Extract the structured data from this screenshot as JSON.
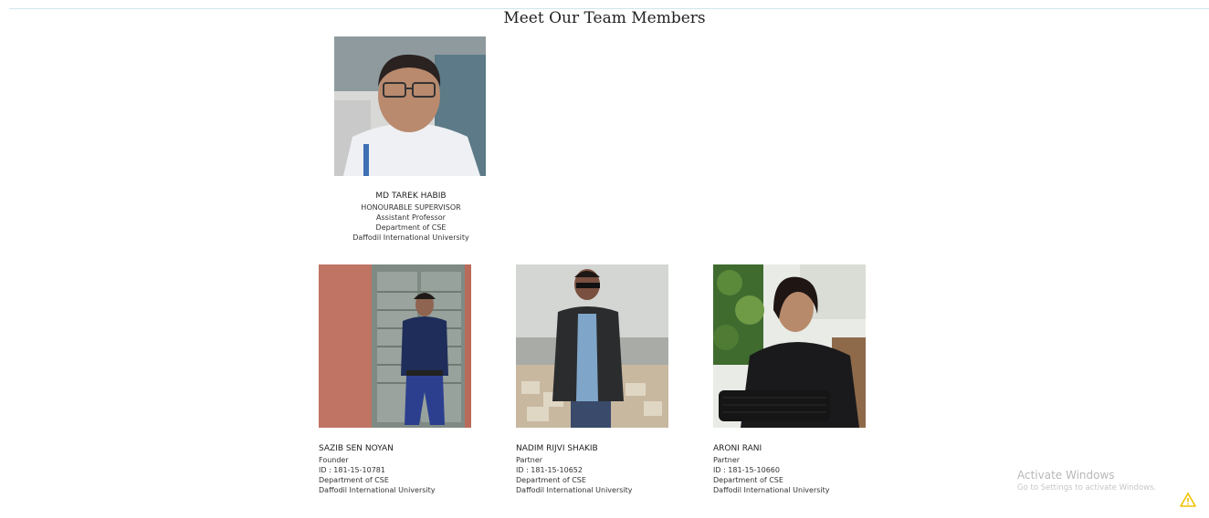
{
  "page": {
    "title": "Meet Our Team Members"
  },
  "supervisor": {
    "name": "MD TAREK HABIB",
    "role": "HONOURABLE SUPERVISOR",
    "designation": "Assistant Professor",
    "department": "Department of CSE",
    "university": "Daffodil International University"
  },
  "members": [
    {
      "name": "SAZIB SEN NOYAN",
      "role": "Founder",
      "id": "ID : 181-15-10781",
      "department": "Department of CSE",
      "university": "Daffodil International University"
    },
    {
      "name": "NADIM RIJVI SHAKIB",
      "role": "Partner",
      "id": "ID : 181-15-10652",
      "department": "Department of CSE",
      "university": "Daffodil International University"
    },
    {
      "name": "ARONI RANI",
      "role": "Partner",
      "id": "ID : 181-15-10660",
      "department": "Department of CSE",
      "university": "Daffodil International University"
    }
  ],
  "watermark": {
    "title": "Activate Windows",
    "subtitle": "Go to Settings to activate Windows."
  },
  "icons": {
    "warning": "warning-icon"
  },
  "colors": {
    "top_line": "#cfe7ea",
    "warning": "#f2c200"
  }
}
